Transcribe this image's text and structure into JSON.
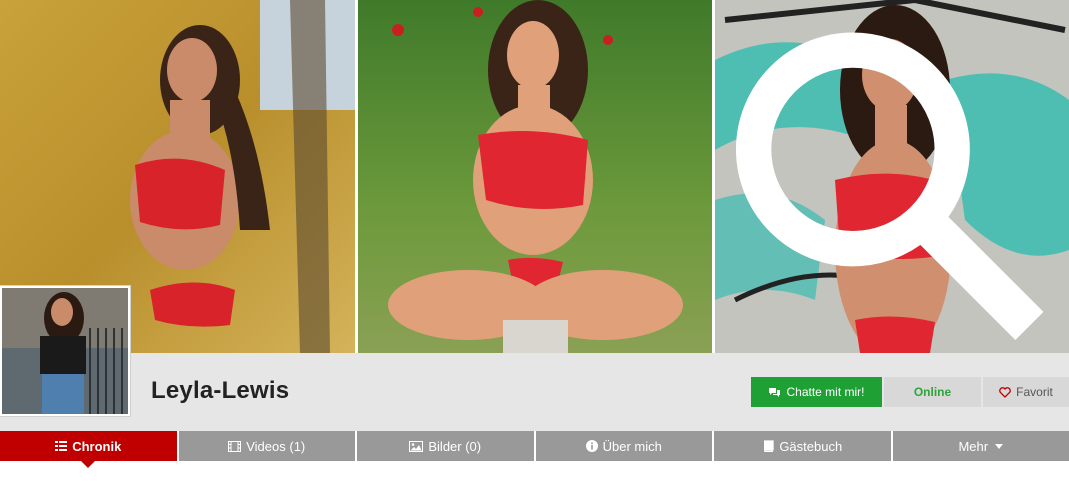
{
  "profile": {
    "name": "Leyla-Lewis"
  },
  "actions": {
    "chat_label": "Chatte mit mir!",
    "status_label": "Online",
    "favorite_label": "Favorit"
  },
  "tabs": [
    {
      "label": "Chronik",
      "icon": "list-icon",
      "active": true
    },
    {
      "label": "Videos (1)",
      "icon": "film-icon",
      "active": false
    },
    {
      "label": "Bilder (0)",
      "icon": "image-icon",
      "active": false
    },
    {
      "label": "Über mich",
      "icon": "info-icon",
      "active": false
    },
    {
      "label": "Gästebuch",
      "icon": "book-icon",
      "active": false
    },
    {
      "label": "Mehr",
      "icon": "chevron-down-icon",
      "active": false
    }
  ],
  "colors": {
    "accent_red": "#c00000",
    "chat_green": "#1fa035",
    "online_green": "#2fa33c",
    "tab_gray": "#999999",
    "band_gray": "#e6e6e6"
  }
}
